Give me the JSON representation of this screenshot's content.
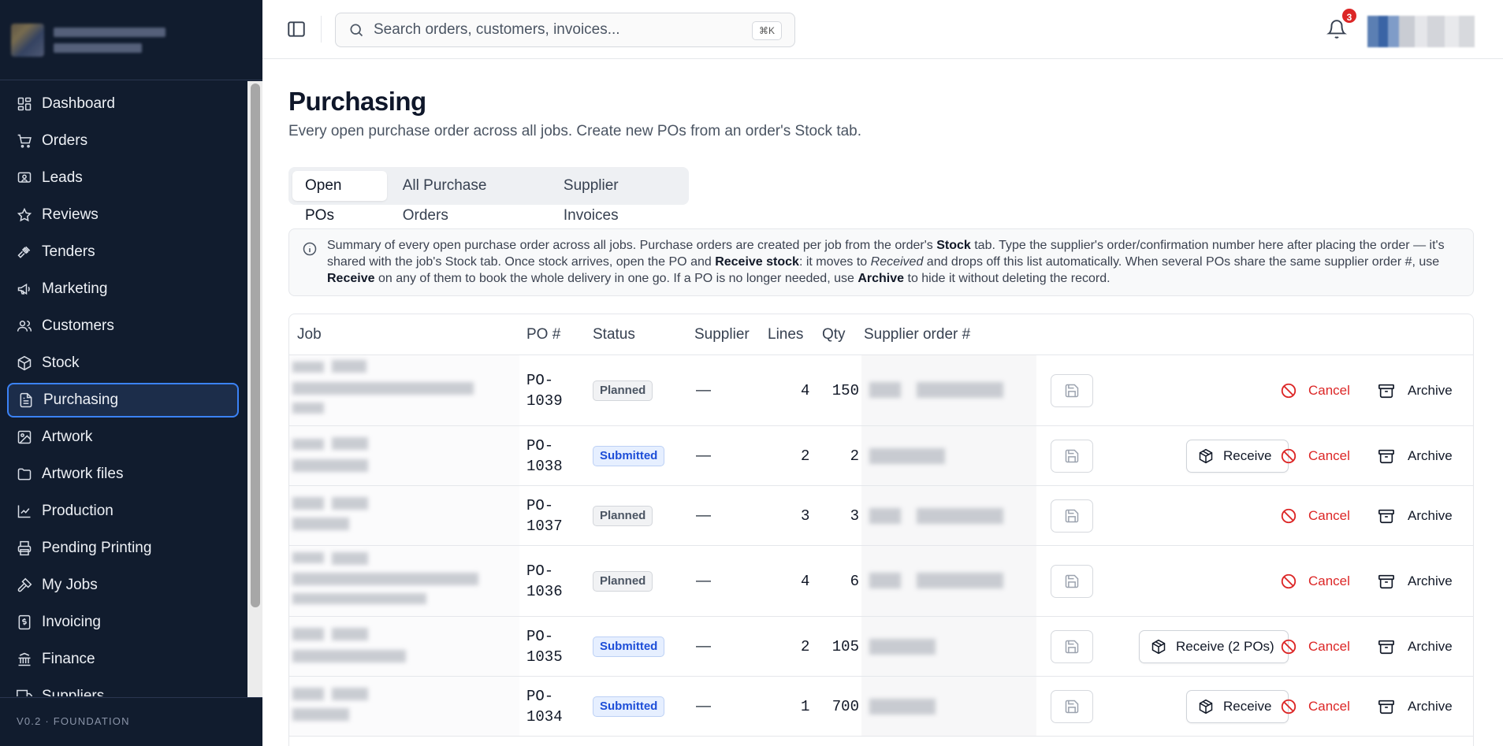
{
  "sidebar": {
    "items": [
      {
        "label": "Dashboard",
        "icon": "dashboard-icon"
      },
      {
        "label": "Orders",
        "icon": "cart-icon"
      },
      {
        "label": "Leads",
        "icon": "leads-icon"
      },
      {
        "label": "Reviews",
        "icon": "star-icon"
      },
      {
        "label": "Tenders",
        "icon": "gavel-icon"
      },
      {
        "label": "Marketing",
        "icon": "megaphone-icon"
      },
      {
        "label": "Customers",
        "icon": "users-icon"
      },
      {
        "label": "Stock",
        "icon": "package-icon"
      },
      {
        "label": "Purchasing",
        "icon": "document-icon",
        "active": true
      },
      {
        "label": "Artwork",
        "icon": "image-icon"
      },
      {
        "label": "Artwork files",
        "icon": "folder-icon"
      },
      {
        "label": "Production",
        "icon": "chart-icon"
      },
      {
        "label": "Pending Printing",
        "icon": "printer-icon"
      },
      {
        "label": "My Jobs",
        "icon": "hammer-icon"
      },
      {
        "label": "Invoicing",
        "icon": "invoice-icon"
      },
      {
        "label": "Finance",
        "icon": "bank-icon"
      },
      {
        "label": "Suppliers",
        "icon": "truck-icon"
      }
    ],
    "footer": "V0.2 · FOUNDATION"
  },
  "header": {
    "search_placeholder": "Search orders, customers, invoices...",
    "search_shortcut": "⌘K",
    "notification_count": "3"
  },
  "page": {
    "title": "Purchasing",
    "subtitle": "Every open purchase order across all jobs. Create new POs from an order's Stock tab.",
    "tabs": [
      "Open POs",
      "All Purchase Orders",
      "Supplier Invoices"
    ],
    "active_tab": "Open POs"
  },
  "info": {
    "t1": "Summary of every open purchase order across all jobs. Purchase orders are created per job from the order's ",
    "b1": "Stock",
    "t2": " tab. Type the supplier's order/confirmation number here after placing the order — it's shared with the job's Stock tab. Once stock arrives, open the PO and ",
    "b2": "Receive stock",
    "t3": ": it moves to ",
    "i1": "Received",
    "t4": " and drops off this list automatically. When several POs share the same supplier order #, use ",
    "b3": "Receive",
    "t5": " on any of them to book the whole delivery in one go. If a PO is no longer needed, use ",
    "b4": "Archive",
    "t6": " to hide it without deleting the record."
  },
  "table": {
    "columns": {
      "job": "Job",
      "po": "PO #",
      "status": "Status",
      "supplier": "Supplier",
      "lines": "Lines",
      "qty": "Qty",
      "supplier_order": "Supplier order #"
    },
    "actions": {
      "receive": "Receive",
      "receive_multi": "Receive (2 POs)",
      "cancel": "Cancel",
      "archive": "Archive"
    },
    "rows": [
      {
        "po_a": "PO-",
        "po_b": "1039",
        "status": "Planned",
        "supplier": "—",
        "lines": "4",
        "qty": "150"
      },
      {
        "po_a": "PO-",
        "po_b": "1038",
        "status": "Submitted",
        "supplier": "—",
        "lines": "2",
        "qty": "2"
      },
      {
        "po_a": "PO-",
        "po_b": "1037",
        "status": "Planned",
        "supplier": "—",
        "lines": "3",
        "qty": "3"
      },
      {
        "po_a": "PO-",
        "po_b": "1036",
        "status": "Planned",
        "supplier": "—",
        "lines": "4",
        "qty": "6"
      },
      {
        "po_a": "PO-",
        "po_b": "1035",
        "status": "Submitted",
        "supplier": "—",
        "lines": "2",
        "qty": "105"
      },
      {
        "po_a": "PO-",
        "po_b": "1034",
        "status": "Submitted",
        "supplier": "—",
        "lines": "1",
        "qty": "700"
      }
    ]
  },
  "colors": {
    "sidebar_bg": "#111c2e",
    "active_border": "#3b82f6",
    "cancel": "#dc2626",
    "submitted": "#1d4ed8",
    "badge": "#dc2626"
  }
}
